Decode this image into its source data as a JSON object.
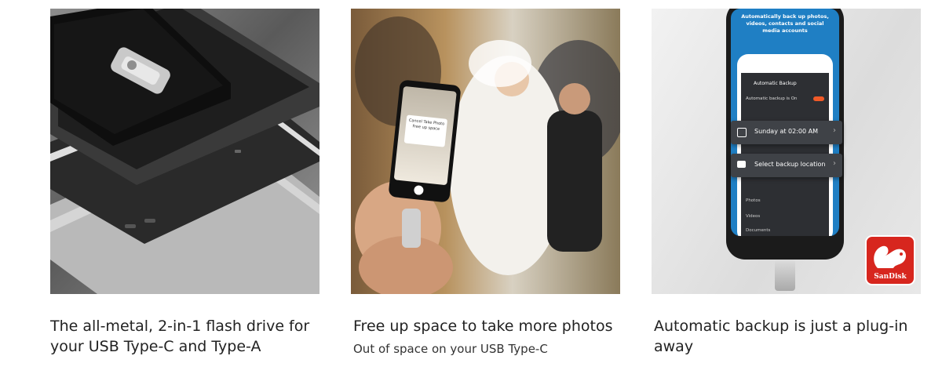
{
  "cards": [
    {
      "caption": "The all-metal, 2-in-1 flash drive for your USB Type-C and Type-A",
      "subcaption": ""
    },
    {
      "caption": "Free up space to take more photos",
      "subcaption": "Out of space on your USB Type-C",
      "phone_screen": {
        "line1": "Cancel  Take Photo",
        "line2": "Free up space"
      }
    },
    {
      "caption": "Automatic backup is just a plug-in away",
      "subcaption": "",
      "phone_banner": "Automatically back up photos, videos, contacts and social media accounts",
      "phone_title": "Automatic Backup",
      "toggle_row": "Automatic backup is On",
      "schedule_row": "Sunday at 02:00 AM",
      "location_row": "Select backup location",
      "list_items": [
        "Photos",
        "Videos",
        "Documents"
      ],
      "brand_logo": "SanDisk"
    }
  ],
  "colors": {
    "phone_blue": "#1f7fc4",
    "dark_popup": "#3f4247",
    "sandisk_red": "#d7261e",
    "toggle_orange": "#f05a28"
  }
}
